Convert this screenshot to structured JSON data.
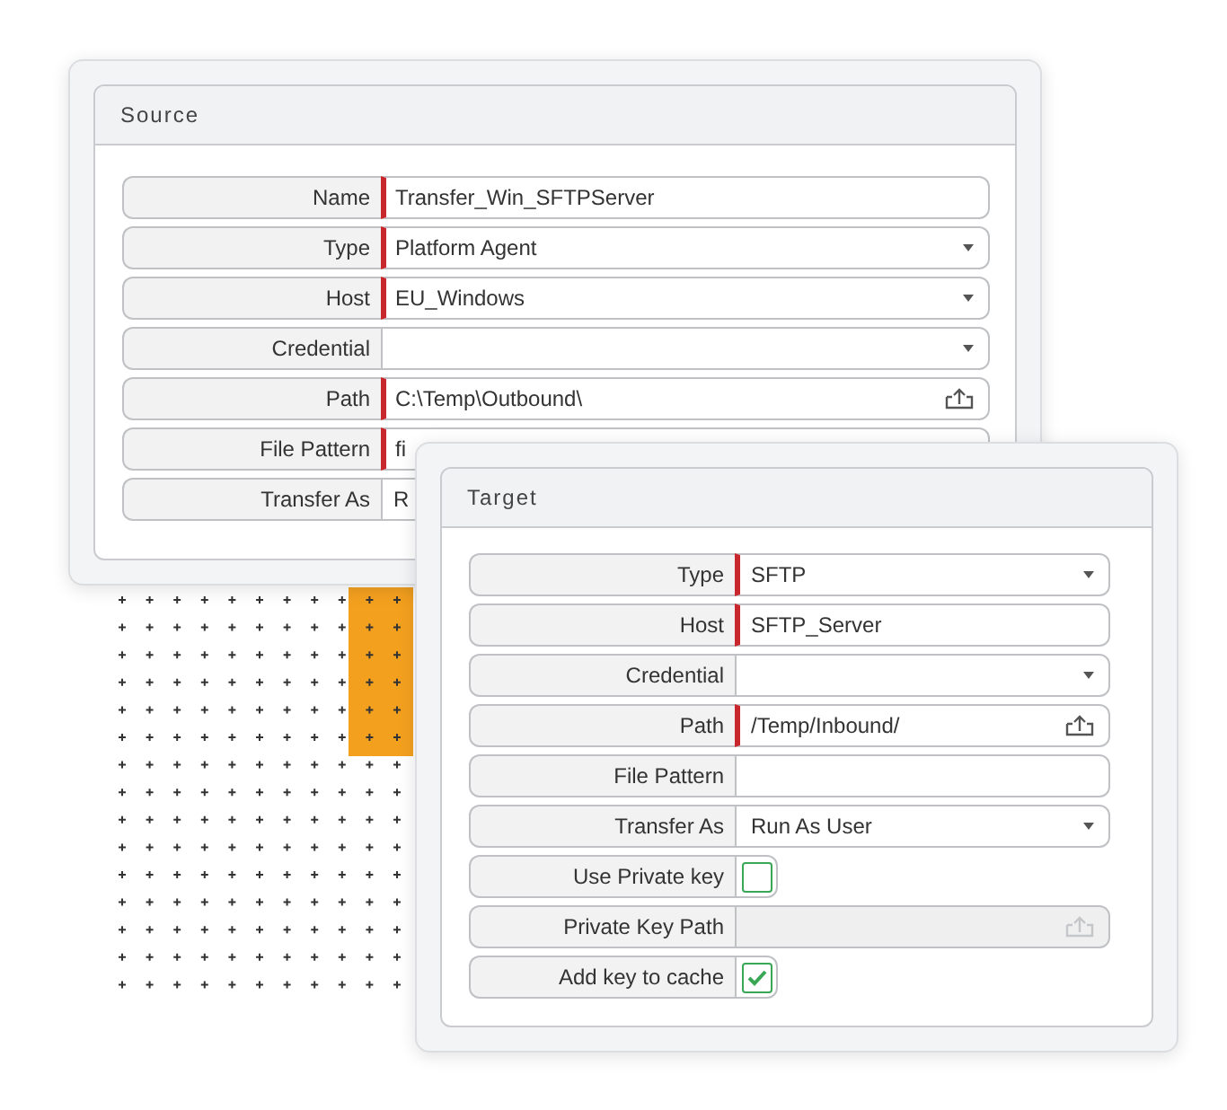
{
  "panels": [
    {
      "title": "Source",
      "fields": [
        {
          "label": "Name",
          "kind": "text",
          "required": true,
          "value": "Transfer_Win_SFTPServer"
        },
        {
          "label": "Type",
          "kind": "select",
          "required": true,
          "value": "Platform Agent"
        },
        {
          "label": "Host",
          "kind": "select",
          "required": true,
          "value": "EU_Windows"
        },
        {
          "label": "Credential",
          "kind": "select",
          "required": false
        },
        {
          "label": "Path",
          "kind": "browse",
          "required": true,
          "value": "C:\\Temp\\Outbound\\"
        },
        {
          "label": "File Pattern",
          "kind": "text",
          "required": true,
          "value": "fi"
        },
        {
          "label": "Transfer As",
          "kind": "text",
          "required": false,
          "value": "R"
        }
      ]
    },
    {
      "title": "Target",
      "fields": [
        {
          "label": "Type",
          "kind": "select",
          "required": true,
          "value": "SFTP"
        },
        {
          "label": "Host",
          "kind": "text",
          "required": true,
          "value": "SFTP_Server"
        },
        {
          "label": "Credential",
          "kind": "select",
          "required": false
        },
        {
          "label": "Path",
          "kind": "browse",
          "required": true,
          "value": "/Temp/Inbound/"
        },
        {
          "label": "File Pattern",
          "kind": "text",
          "required": false
        },
        {
          "label": "Transfer As",
          "kind": "select",
          "required": false,
          "value": "Run As User"
        },
        {
          "label": "Use Private key",
          "kind": "checkbox",
          "checked": false
        },
        {
          "label": "Private Key Path",
          "kind": "browse",
          "required": false,
          "disabled": true
        },
        {
          "label": "Add key to cache",
          "kind": "checkbox",
          "checked": true
        }
      ]
    }
  ]
}
